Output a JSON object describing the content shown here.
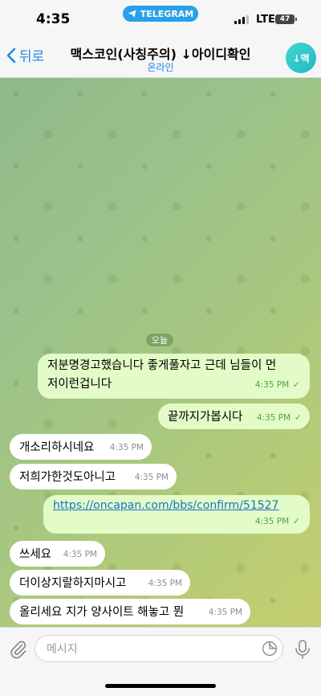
{
  "status": {
    "time": "4:35",
    "app_pill": "TELEGRAM",
    "network": "LTE",
    "battery": "47"
  },
  "header": {
    "back_label": "뒤로",
    "title": "맥스코인(사칭주의) ↓아이디확인",
    "subtitle": "온라인",
    "avatar_text": "↓맥"
  },
  "chat": {
    "day_label": "오늘",
    "messages": [
      {
        "dir": "out",
        "lines": [
          "저분명경고했습니다 좋게풀자고 근데 님들이 먼",
          "저이런겁니다"
        ],
        "time": "4:35 PM"
      },
      {
        "dir": "out",
        "text": "끝까지가봅시다",
        "time": "4:35 PM"
      },
      {
        "dir": "in",
        "text": "개소리하시네요",
        "time": "4:35 PM"
      },
      {
        "dir": "in",
        "text": "저희가한것도아니고",
        "time": "4:35 PM"
      },
      {
        "dir": "out",
        "text": "https://oncapan.com/bbs/confirm/51527",
        "time": "4:35 PM",
        "link": true
      },
      {
        "dir": "in",
        "text": "쓰세요",
        "time": "4:35 PM"
      },
      {
        "dir": "in",
        "text": "더이상지랄하지마시고",
        "time": "4:35 PM"
      },
      {
        "dir": "in",
        "text": "올리세요 지가 양사이트 해놓고 뭔",
        "time": "4:35 PM"
      }
    ]
  },
  "input": {
    "placeholder": "메시지"
  },
  "colors": {
    "accent": "#1b88e5",
    "outgoing": "#e2fbc7",
    "incoming": "#ffffff"
  }
}
